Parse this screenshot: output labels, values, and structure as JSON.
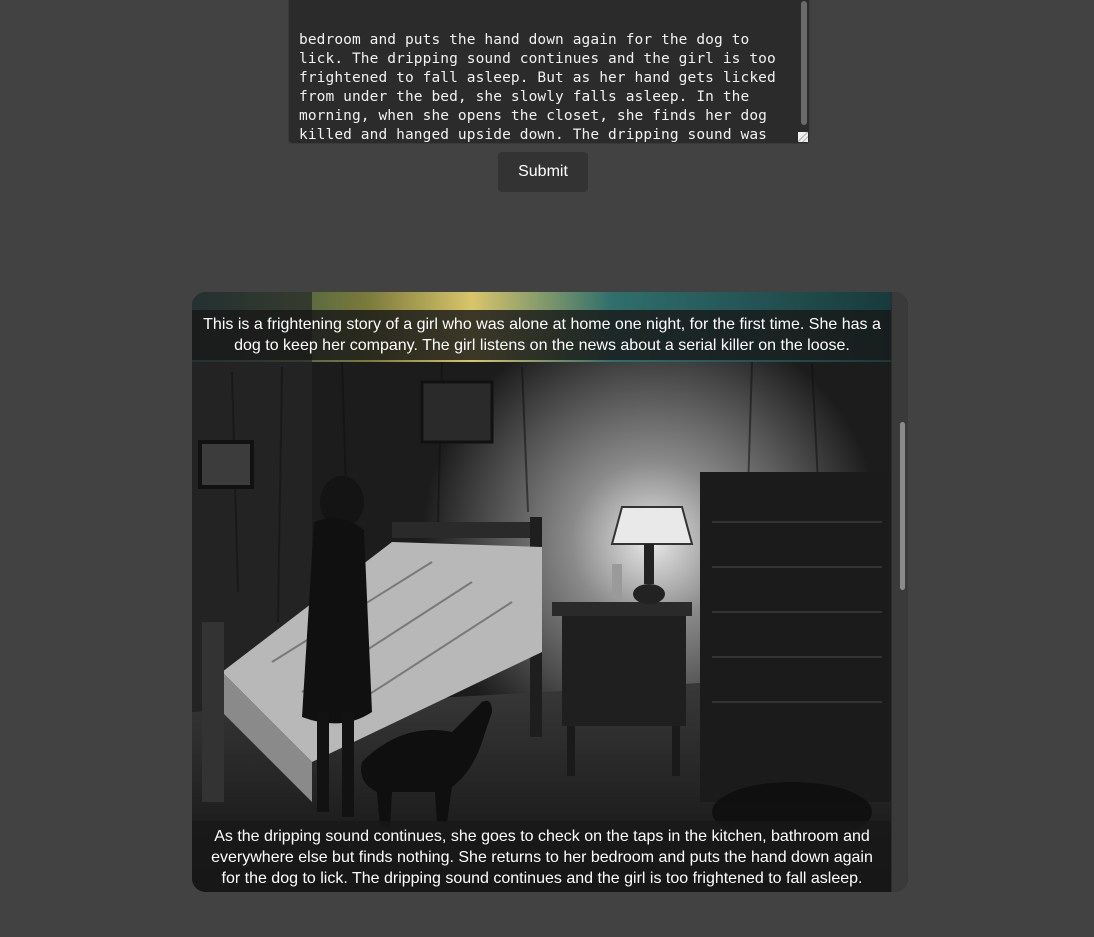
{
  "story_input": {
    "value": "bedroom and puts the hand down again for the dog to\nlick. The dripping sound continues and the girl is too\nfrightened to fall asleep. But as her hand gets licked\nfrom under the bed, she slowly falls asleep. In the\nmorning, when she opens the closet, she finds her dog\nkilled and hanged upside down. The dripping sound was\nfrom the dog’s blood. On the closet doors, she sees a\nmessage – “Humans can lick, too”."
  },
  "submit": {
    "label": "Submit"
  },
  "story": {
    "caption_top": "This is a frightening story of a girl who was alone at home one night, for the first time. She has a dog to keep her company. The girl listens on the news about a serial killer on the loose.",
    "caption_bottom": "As the dripping sound continues, she goes to check on the taps in the kitchen, bathroom and everywhere else but finds nothing. She returns to her bedroom and puts the hand down again for the dog to lick. The dripping sound continues and the girl is too frightened to fall asleep."
  },
  "colors": {
    "page_background": "#424242",
    "input_background": "#2b2b2b",
    "button_background": "#333333"
  }
}
